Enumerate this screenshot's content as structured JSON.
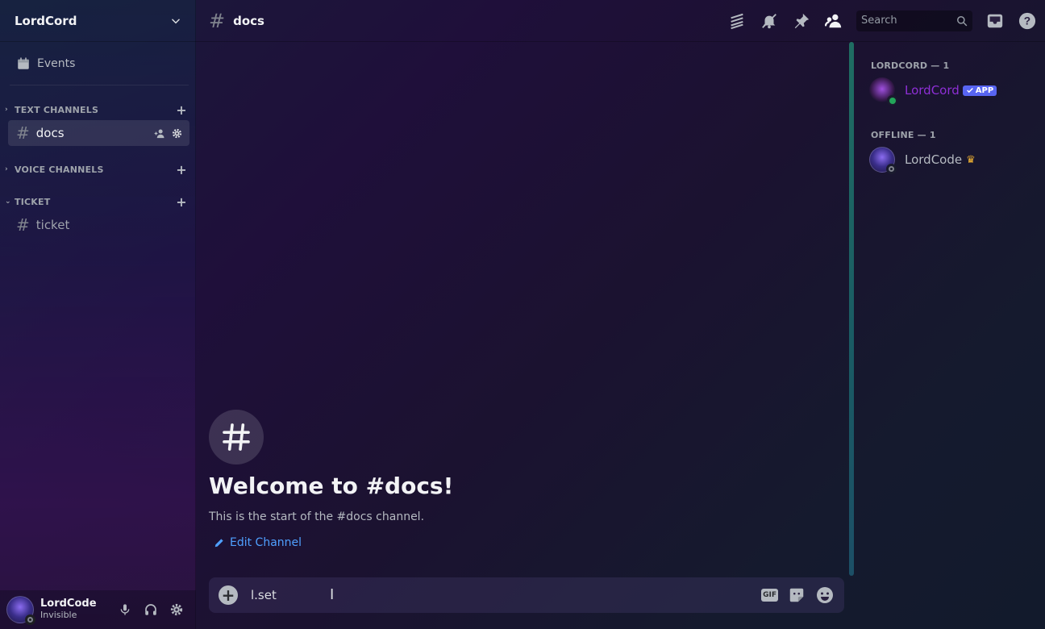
{
  "server": {
    "name": "LordCord"
  },
  "sidebar": {
    "events_label": "Events",
    "categories": [
      {
        "label": "TEXT CHANNELS"
      },
      {
        "label": "VOICE CHANNELS"
      },
      {
        "label": "TICKET"
      }
    ],
    "channels": [
      {
        "name": "docs"
      },
      {
        "name": "ticket"
      }
    ]
  },
  "user": {
    "name": "LordCode",
    "status": "Invisible"
  },
  "topbar": {
    "channel": "docs",
    "search_placeholder": "Search"
  },
  "chat": {
    "welcome_title": "Welcome to #docs!",
    "welcome_sub": "This is the start of the #docs channel.",
    "edit_channel": "Edit Channel",
    "composer_text": "l.set",
    "gif_label": "GIF"
  },
  "members": {
    "groups": [
      {
        "label": "LORDCORD — 1"
      },
      {
        "label": "OFFLINE — 1"
      }
    ],
    "items": [
      {
        "name": "LordCord",
        "badge": "APP",
        "color": "#8e2fd6"
      },
      {
        "name": "LordCode",
        "color": "#b5bac1"
      }
    ]
  },
  "colors": {
    "link": "#4fa0ff",
    "online": "#23a55a",
    "badge": "#5865f2"
  }
}
